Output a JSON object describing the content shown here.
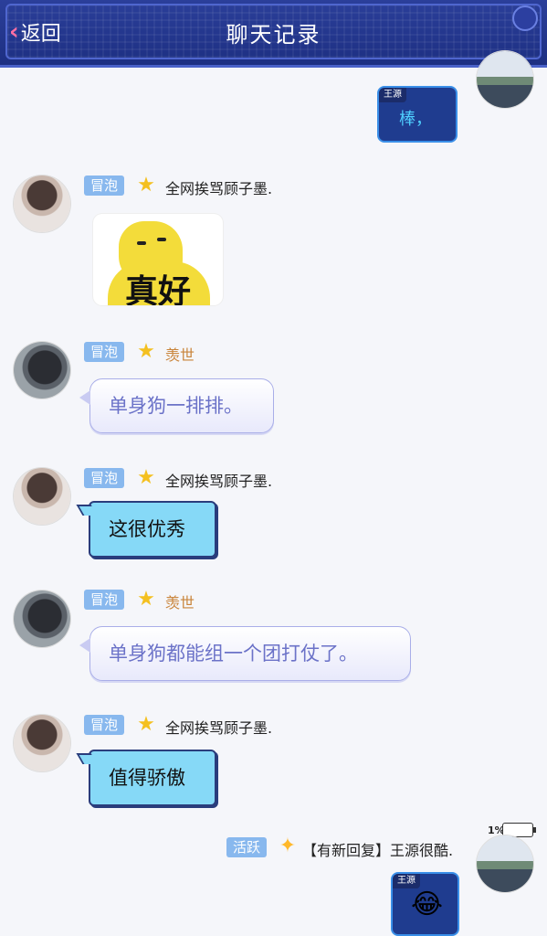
{
  "header": {
    "back_label": "返回",
    "title": "聊天记录"
  },
  "messages": [
    {
      "sender": "王源",
      "self": true,
      "text": "棒，"
    },
    {
      "tag": "冒泡",
      "username": "全网挨骂顾子墨.",
      "type": "sticker",
      "sticker_text": "真好"
    },
    {
      "tag": "冒泡",
      "username": "羡世",
      "text": "单身狗一排排。"
    },
    {
      "tag": "冒泡",
      "username": "全网挨骂顾子墨.",
      "text": "这很优秀"
    },
    {
      "tag": "冒泡",
      "username": "羡世",
      "text": "单身狗都能组一个团打仗了。"
    },
    {
      "tag": "冒泡",
      "username": "全网挨骂顾子墨.",
      "text": "值得骄傲"
    },
    {
      "tag": "活跃",
      "username": "【有新回复】王源很酷.",
      "self": true,
      "sender": "王源",
      "emoji": "😂",
      "battery": "1%"
    }
  ],
  "colors": {
    "header": "#1d2f82",
    "tag": "#88b8ee",
    "cyan_bubble": "#86d9f7",
    "lavender_text": "#6b72c8"
  }
}
